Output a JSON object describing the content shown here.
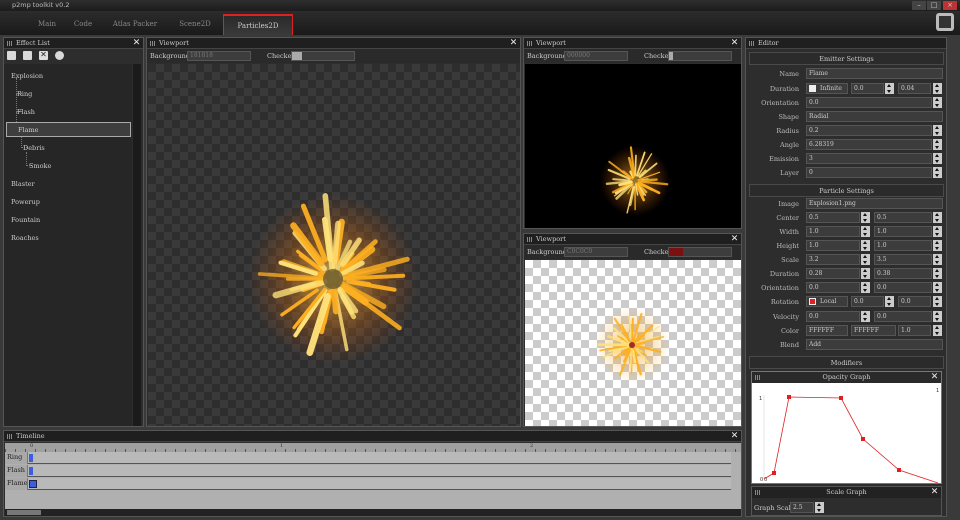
{
  "app": {
    "title": "p2mp toolkit v0.2"
  },
  "tabs": [
    "Main",
    "Code",
    "Atlas Packer",
    "Scene2D",
    "Particles2D"
  ],
  "effect_list": {
    "title": "Effect List",
    "items": [
      "Explosion",
      "Ring",
      "Flash",
      "Flame",
      "Debris",
      "Smoke",
      "Blaster",
      "Powerup",
      "Fountain",
      "Roaches"
    ],
    "selected": "Flame"
  },
  "viewport_main": {
    "title": "Viewport",
    "background_label": "Background",
    "background_value": "181818",
    "checker_label": "Checker"
  },
  "viewport_black": {
    "title": "Viewport",
    "background_label": "Background",
    "background_value": "000000",
    "checker_label": "Checker"
  },
  "viewport_white": {
    "title": "Viewport",
    "background_label": "Background",
    "background_value": "C0C0C0",
    "checker_label": "Checker"
  },
  "editor": {
    "title": "Editor",
    "emitter": {
      "header": "Emitter Settings",
      "name_label": "Name",
      "name": "Flame",
      "duration_label": "Duration",
      "infinite_label": "Infinite",
      "duration_min": "0.0",
      "duration_max": "0.04",
      "orientation_label": "Orientation",
      "orientation": "0.0",
      "shape_label": "Shape",
      "shape": "Radial",
      "radius_label": "Radius",
      "radius": "0.2",
      "angle_label": "Angle",
      "angle": "6.28319",
      "emission_label": "Emission",
      "emission": "3",
      "layer_label": "Layer",
      "layer": "0"
    },
    "particle": {
      "header": "Particle Settings",
      "image_label": "Image",
      "image": "Explosion1.png",
      "center_label": "Center",
      "center_a": "0.5",
      "center_b": "0.5",
      "width_label": "Width",
      "width_a": "1.0",
      "width_b": "1.0",
      "height_label": "Height",
      "height_a": "1.0",
      "height_b": "1.0",
      "scale_label": "Scale",
      "scale_a": "3.2",
      "scale_b": "3.5",
      "duration_label": "Duration",
      "duration_a": "0.28",
      "duration_b": "0.38",
      "orientation_label": "Orientation",
      "orientation_a": "0.0",
      "orientation_b": "0.0",
      "rotation_label": "Rotation",
      "local_label": "Local",
      "rotation_a": "0.0",
      "rotation_b": "0.0",
      "velocity_label": "Velocity",
      "velocity_a": "0.0",
      "velocity_b": "0.0",
      "color_label": "Color",
      "color_a": "FFFFFF",
      "color_b": "FFFFFF",
      "color_c": "1.0",
      "blend_label": "Blend",
      "blend": "Add"
    },
    "modifiers": {
      "header": "Modifiers",
      "opacity_graph_title": "Opacity Graph",
      "graph_y_max": "1",
      "graph_y_min": "0",
      "graph_x_min": "0",
      "graph_x_max": "1",
      "scale_graph_title": "Scale Graph",
      "graph_scale_label": "Graph Scale",
      "graph_scale_value": "2.5"
    }
  },
  "timeline": {
    "title": "Timeline",
    "rows": [
      "Ring",
      "Flash",
      "Flame"
    ],
    "ruler_marks": [
      "0",
      "1",
      "2"
    ]
  }
}
